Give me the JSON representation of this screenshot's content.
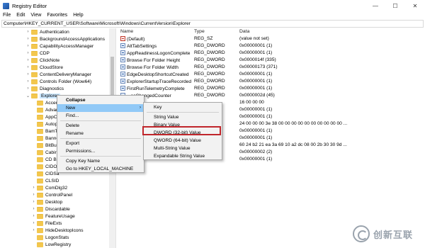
{
  "window": {
    "title": "Registry Editor",
    "controls": [
      "—",
      "☐",
      "✕"
    ]
  },
  "menubar": [
    "File",
    "Edit",
    "View",
    "Favorites",
    "Help"
  ],
  "address": "Computer\\HKEY_CURRENT_USER\\Software\\Microsoft\\Windows\\CurrentVersion\\Explorer",
  "tree": {
    "items": [
      "Authentication",
      "BackgroundAccessApplications",
      "CapabilityAccessManager",
      "CDP",
      "ClickNote",
      "CloudStore",
      "ContentDeliveryManager",
      "Controls Folder (Wow64)",
      "Diagnostics",
      "Explorer",
      "Accer",
      "Advar",
      "AppC",
      "Autop",
      "BamT",
      "Banne",
      "BitBu",
      "Cabir",
      "CD Bu",
      "CIDO",
      "CIDSa",
      "CLSID",
      "ComDlg32",
      "ControlPanel",
      "Desktop",
      "Discardable",
      "FeatureUsage",
      "FileExts",
      "HideDesktopIcons",
      "LogonStats",
      "LowRegistry"
    ]
  },
  "list": {
    "headers": {
      "name": "Name",
      "type": "Type",
      "data": "Data"
    },
    "rows": [
      {
        "name": "(Default)",
        "type": "REG_SZ",
        "data": "(value not set)",
        "icon": "string-value-icon"
      },
      {
        "name": "AltTabSettings",
        "type": "REG_DWORD",
        "data": "0x00000001 (1)",
        "icon": "binary-value-icon"
      },
      {
        "name": "AppReadinessLogonComplete",
        "type": "REG_DWORD",
        "data": "0x00000001 (1)",
        "icon": "binary-value-icon"
      },
      {
        "name": "Browse For Folder Height",
        "type": "REG_DWORD",
        "data": "0x0000014f (335)",
        "icon": "binary-value-icon"
      },
      {
        "name": "Browse For Folder Width",
        "type": "REG_DWORD",
        "data": "0x00000173 (371)",
        "icon": "binary-value-icon"
      },
      {
        "name": "EdgeDesktopShortcutCreated",
        "type": "REG_DWORD",
        "data": "0x00000001 (1)",
        "icon": "binary-value-icon"
      },
      {
        "name": "ExplorerStartupTraceRecorded",
        "type": "REG_DWORD",
        "data": "0x00000001 (1)",
        "icon": "binary-value-icon"
      },
      {
        "name": "FirstRunTelemetryComplete",
        "type": "REG_DWORD",
        "data": "0x00000001 (1)",
        "icon": "binary-value-icon"
      },
      {
        "name": "...ocChangedCounter",
        "type": "REG_DWORD",
        "data": "0x0000002d (45)",
        "icon": "binary-value-icon"
      },
      {
        "name": "",
        "type": "",
        "data": "16 00 00 00",
        "icon": ""
      },
      {
        "name": "",
        "type": "",
        "data": "0x00000001 (1)",
        "icon": ""
      },
      {
        "name": "",
        "type": "",
        "data": "0x00000001 (1)",
        "icon": ""
      },
      {
        "name": "",
        "type": "",
        "data": "24 00 00 00 3e 38 00 00 00 00 00 00 00 00 00 00 ...",
        "icon": ""
      },
      {
        "name": "",
        "type": "",
        "data": "0x00000001 (1)",
        "icon": ""
      },
      {
        "name": "",
        "type": "",
        "data": "0x00000001 (1)",
        "icon": ""
      },
      {
        "name": "",
        "type": "",
        "data": "60 24 b2 21 ea 3a 69 10 a2 dc 08 00 2b 30 30 9d ...",
        "icon": ""
      },
      {
        "name": "",
        "type": "",
        "data": "0x00000002 (2)",
        "icon": ""
      },
      {
        "name": "",
        "type": "",
        "data": "0x00000001 (1)",
        "icon": ""
      }
    ]
  },
  "context_menu": {
    "items": [
      "Collapse",
      "New",
      "Find...",
      "Delete",
      "Rename",
      "Export",
      "Permissions...",
      "Copy Key Name",
      "Go to HKEY_LOCAL_MACHINE"
    ]
  },
  "submenu": {
    "items": [
      "Key",
      "String Value",
      "Binary Value",
      "DWORD (32-bit) Value",
      "QWORD (64-bit) Value",
      "Multi-String Value",
      "Expandable String Value"
    ],
    "highlighted": "DWORD (32-bit) Value"
  },
  "watermark": {
    "text": "创新互联"
  },
  "colors": {
    "selection": "#cce8ff",
    "menu_highlight": "#91c9f7",
    "callout": "#c0262b",
    "folder": "#f3c74e"
  }
}
